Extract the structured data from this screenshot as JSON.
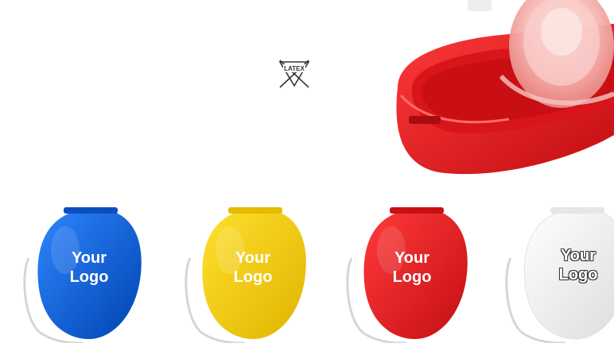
{
  "latex_badge": {
    "text": "LATEX",
    "icon": "no-latex-icon"
  },
  "main_product": {
    "icon": "cpr-mask-case-icon",
    "color": "#e41e26"
  },
  "pouches": [
    {
      "line1": "Your",
      "line2": "Logo",
      "color": "#0a5fd8"
    },
    {
      "line1": "Your",
      "line2": "Logo",
      "color": "#f2cc00"
    },
    {
      "line1": "Your",
      "line2": "Logo",
      "color": "#e41e26"
    },
    {
      "line1": "Your",
      "line2": "Logo",
      "color": "#f4f4f4"
    }
  ]
}
